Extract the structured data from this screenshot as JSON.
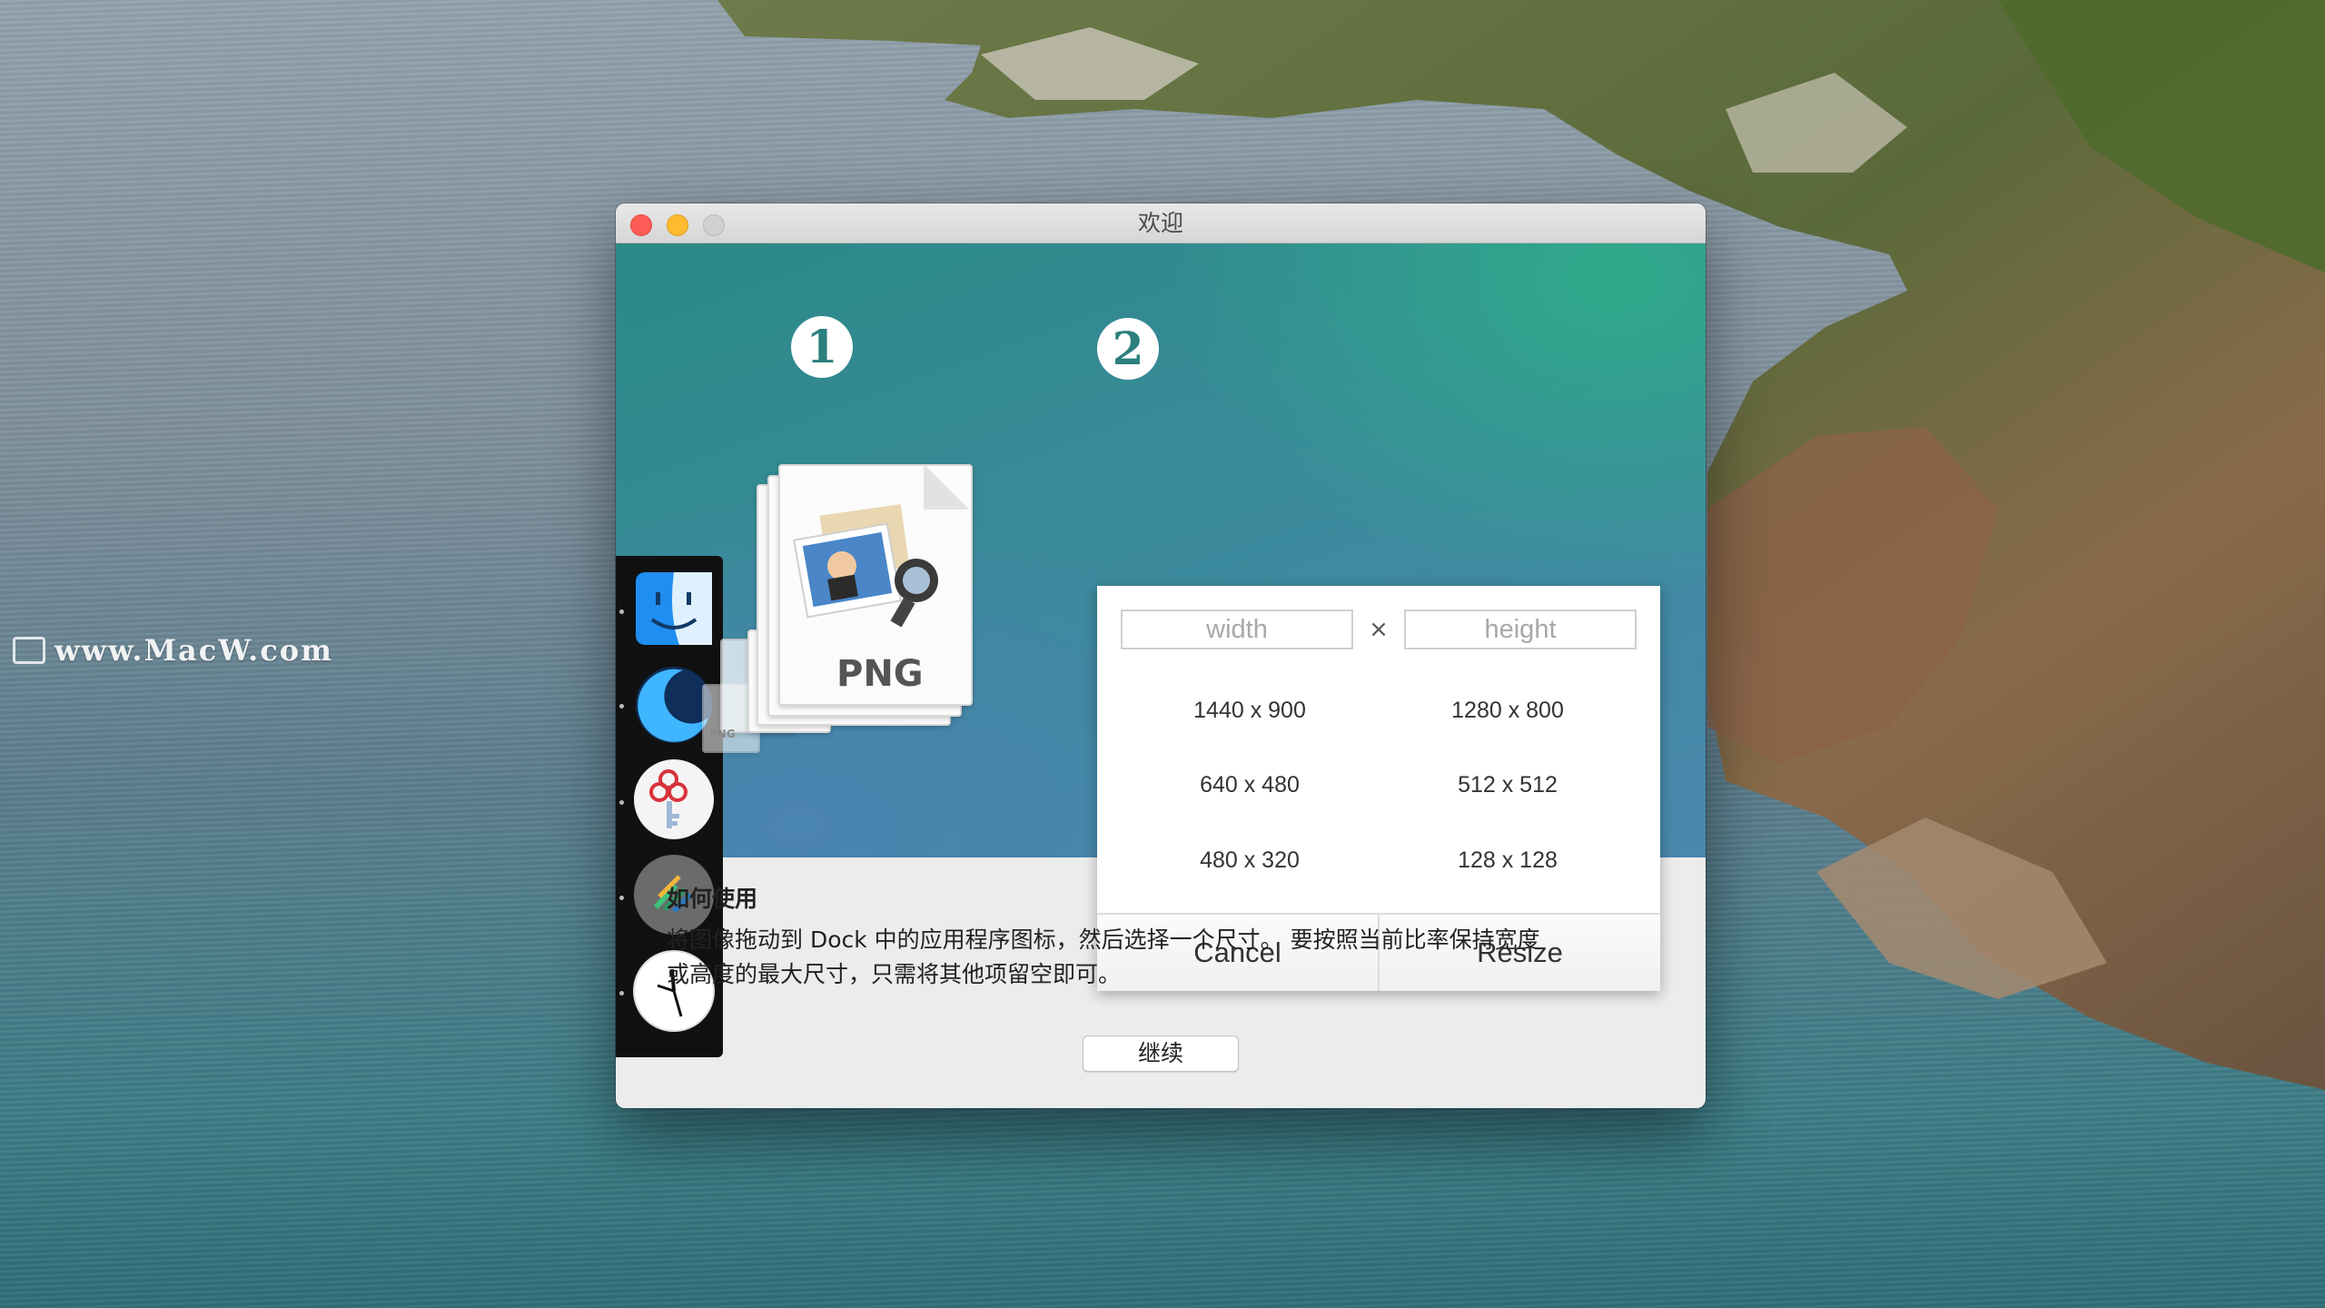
{
  "desktop": {
    "watermark": "www.MacW.com"
  },
  "window": {
    "title": "欢迎",
    "steps": [
      "1",
      "2"
    ],
    "dock_icons": [
      "finder-icon",
      "moon-app-icon",
      "key-app-icon",
      "stripes-app-icon",
      "clock-app-icon"
    ],
    "file_icon": {
      "type_label": "PNG"
    },
    "resize_panel": {
      "width_placeholder": "width",
      "height_placeholder": "height",
      "times_symbol": "×",
      "presets": [
        "1440 x 900",
        "1280 x 800",
        "640 x 480",
        "512 x 512",
        "480 x 320",
        "128 x 128"
      ],
      "cancel_label": "Cancel",
      "resize_label": "Resize"
    },
    "howto": {
      "title": "如何使用",
      "line1": "将图像拖动到 Dock 中的应用程序图标，然后选择一个尺寸。 要按照当前比率保持宽度",
      "line2": "或高度的最大尺寸，只需将其他项留空即可。"
    },
    "continue_label": "继续"
  },
  "colors": {
    "hero_teal": "#2a8a87",
    "hero_blue": "#4a88ad",
    "close": "#fc5c55",
    "minimize": "#fdbb2e",
    "zoom_disabled": "#d0d0d0"
  }
}
